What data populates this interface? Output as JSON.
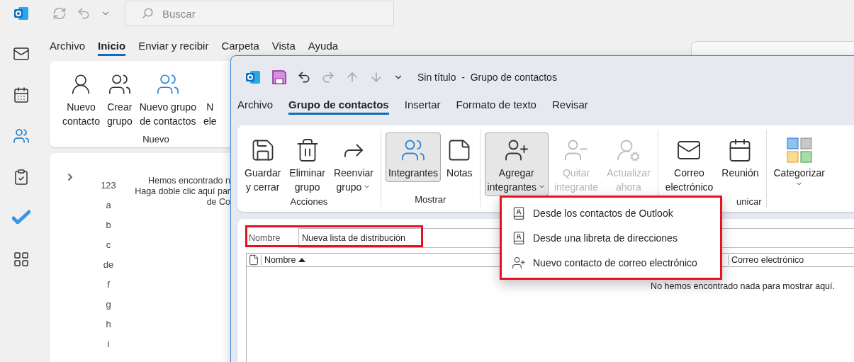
{
  "quick_access": {
    "search_placeholder": "Buscar"
  },
  "rail": [
    {
      "selected": false
    },
    {
      "selected": false
    },
    {
      "selected": true
    },
    {
      "selected": false
    },
    {
      "selected": false
    },
    {
      "selected": false
    }
  ],
  "tabs": [
    {
      "label": "Archivo",
      "selected": false
    },
    {
      "label": "Inicio",
      "selected": true
    },
    {
      "label": "Enviar y recibir",
      "selected": false
    },
    {
      "label": "Carpeta",
      "selected": false
    },
    {
      "label": "Vista",
      "selected": false
    },
    {
      "label": "Ayuda",
      "selected": false
    }
  ],
  "ribbon": {
    "buttons": [
      {
        "lines": [
          "Nuevo",
          "contacto"
        ]
      },
      {
        "lines": [
          "Crear",
          "grupo"
        ]
      },
      {
        "lines": [
          "Nuevo grupo",
          "de contactos"
        ]
      },
      {
        "lines": [
          "N",
          "ele"
        ]
      }
    ],
    "group_label": "Nuevo"
  },
  "index": [
    "123",
    "a",
    "b",
    "c",
    "de",
    "f",
    "g",
    "h",
    "i"
  ],
  "empty_message": [
    "Hemos encontrado n",
    "Haga doble clic aquí par",
    "de Co"
  ],
  "contact_group_window": {
    "title": "Sin título  -  Grupo de contactos",
    "tabs": [
      {
        "label": "Archivo",
        "selected": false
      },
      {
        "label": "Grupo de contactos",
        "selected": true
      },
      {
        "label": "Insertar",
        "selected": false
      },
      {
        "label": "Formato de texto",
        "selected": false
      },
      {
        "label": "Revisar",
        "selected": false
      }
    ],
    "groups": [
      {
        "label": "Acciones",
        "buttons": [
          {
            "lines": [
              "Guardar",
              "y cerrar"
            ],
            "disabled": false,
            "active": false,
            "dropdown": false
          },
          {
            "lines": [
              "Eliminar",
              "grupo"
            ],
            "disabled": false,
            "active": false,
            "dropdown": false
          },
          {
            "lines": [
              "Reenviar",
              "grupo"
            ],
            "disabled": false,
            "active": false,
            "dropdown": true
          }
        ]
      },
      {
        "label": "Mostrar",
        "buttons": [
          {
            "lines": [
              "Integrantes"
            ],
            "disabled": false,
            "active": true,
            "dropdown": false
          },
          {
            "lines": [
              "Notas"
            ],
            "disabled": false,
            "active": false,
            "dropdown": false
          }
        ]
      },
      {
        "buttons": [
          {
            "lines": [
              "Agregar",
              "integrantes"
            ],
            "disabled": false,
            "active": true,
            "dropdown": true
          },
          {
            "lines": [
              "Quitar",
              "integrante"
            ],
            "disabled": true,
            "active": false,
            "dropdown": false
          },
          {
            "lines": [
              "Actualizar",
              "ahora"
            ],
            "disabled": true,
            "active": false,
            "dropdown": false
          }
        ]
      },
      {
        "label": "unicar",
        "buttons": [
          {
            "lines": [
              "Correo",
              "electrónico"
            ],
            "disabled": false,
            "active": false,
            "dropdown": false
          },
          {
            "lines": [
              "Reunión"
            ],
            "disabled": false,
            "active": false,
            "dropdown": false
          }
        ]
      },
      {
        "buttons": [
          {
            "lines": [
              "Categorizar"
            ],
            "disabled": false,
            "active": false,
            "dropdown": true
          }
        ]
      }
    ],
    "name_label": "Nombre",
    "name_value": "Nueva lista de distribución",
    "columns": [
      {
        "label": "Nombre",
        "sorted_ascending": true
      },
      {
        "label": "Correo electrónico"
      }
    ],
    "empty_list": "No hemos encontrado nada para mostrar aquí.",
    "menu": [
      "Desde los contactos de Outlook",
      "Desde una libreta de direcciones",
      "Nuevo contacto de correo electrónico"
    ]
  }
}
